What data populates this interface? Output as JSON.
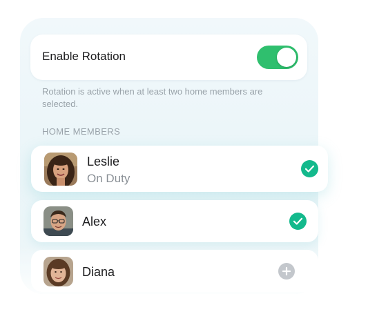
{
  "settings": {
    "rotation_label": "Enable Rotation",
    "rotation_enabled": true,
    "hint": "Rotation is active when at least two home members are selected."
  },
  "members": {
    "header": "HOME MEMBERS",
    "items": [
      {
        "name": "Leslie",
        "status": "On Duty",
        "selected": true
      },
      {
        "name": "Alex",
        "status": "",
        "selected": true
      },
      {
        "name": "Diana",
        "status": "",
        "selected": false
      }
    ]
  },
  "colors": {
    "toggle_on": "#2fbf6e",
    "check": "#13b98c",
    "add": "#c3c7cc"
  },
  "icons": {
    "selected": "checkmark-icon",
    "unselected": "plus-icon"
  }
}
